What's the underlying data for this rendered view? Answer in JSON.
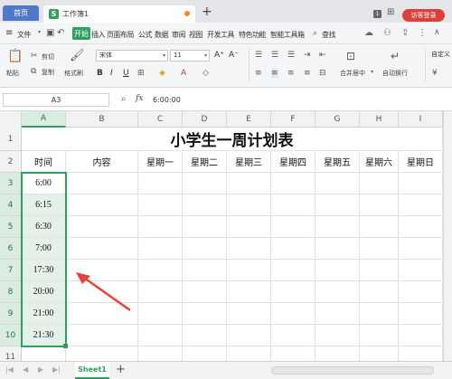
{
  "tabs": {
    "home": "首页",
    "file": "工作簿1",
    "file_icon": "S",
    "new_tab": "+"
  },
  "window": {
    "badge": "1",
    "login": "访客登录"
  },
  "menu": {
    "file": "文件",
    "items": [
      "开始",
      "插入",
      "页面布局",
      "公式",
      "数据",
      "审阅",
      "视图",
      "开发工具",
      "特色功能",
      "智能工具箱"
    ],
    "search": "查找"
  },
  "toolbar": {
    "paste": "粘贴",
    "cut": "剪切",
    "copy": "复制",
    "format_painter": "格式刷",
    "font_name": "宋体",
    "font_size": "11",
    "bold": "B",
    "italic": "I",
    "underline": "U",
    "grow": "A⁺",
    "shrink": "A⁻",
    "merge": "合并居中",
    "wrap": "自动换行",
    "custom": "自定义"
  },
  "formula_bar": {
    "cell_ref": "A3",
    "fx": "fx",
    "value": "6:00:00"
  },
  "columns": [
    "A",
    "B",
    "C",
    "D",
    "E",
    "F",
    "G",
    "H",
    "I"
  ],
  "rows": [
    "1",
    "2",
    "3",
    "4",
    "5",
    "6",
    "7",
    "8",
    "9",
    "10",
    "11"
  ],
  "sheet": {
    "title": "小学生一周计划表",
    "headers": [
      "时间",
      "内容",
      "星期一",
      "星期二",
      "星期三",
      "星期四",
      "星期五",
      "星期六",
      "星期日"
    ],
    "times": [
      "6:00",
      "6:15",
      "6:30",
      "7:00",
      "17:30",
      "20:00",
      "21:00",
      "21:30"
    ]
  },
  "sheetbar": {
    "tab": "Sheet1",
    "add": "+"
  },
  "colors": {
    "accent": "#2f9e5f",
    "home_tab": "#4f78c9",
    "login": "#d9423c",
    "arrow": "#e8423b"
  }
}
